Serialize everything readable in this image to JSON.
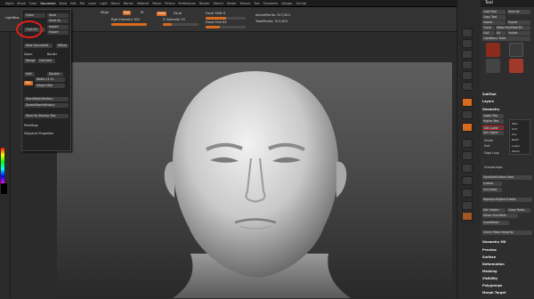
{
  "menubar": {
    "items": [
      "Alpha",
      "Brush",
      "Color",
      "Document",
      "Draw",
      "Edit",
      "File",
      "Layer",
      "Light",
      "Macro",
      "Marker",
      "Material",
      "Movie",
      "Picture",
      "Preferences",
      "Render",
      "Stencil",
      "Stroke",
      "Texture",
      "Tool",
      "Transform",
      "Zplugin",
      "Zscript"
    ],
    "active_index": 3
  },
  "shelf": {
    "light_box": "LightBox",
    "mrgb": "Mrgb",
    "rgb": "Rgb",
    "m": "M",
    "rgb_intensity": "Rgb Intensity 100",
    "zadd": "Zadd",
    "zsub": "Zsub",
    "z_intensity": "Z Intensity 25",
    "focal_shift": "Focal Shift 0",
    "draw_size": "Draw Size 64",
    "active_points": "ActivePoints: 317,612",
    "total_points": "TotalPoints: 317,612"
  },
  "dropdown": {
    "open": "Open",
    "save": "Save",
    "save_as": "Save As",
    "clip_link": "ClipLink",
    "import": "Import",
    "export": "Export",
    "new_document": "New Document",
    "wsize": "WSize",
    "zoom": "Zoom",
    "border": "Border",
    "crop": "Crop",
    "range": "Range",
    "contrast": "Contrast",
    "half": "Half",
    "double": "Double",
    "pro": "Pro",
    "width": "Width 1174",
    "height": "Height 800",
    "store_depth": "StoreDepthHistory",
    "delete_depth": "DeleteDepthHistory",
    "save_startup": "Save As Startup Doc",
    "paint_stop": "PaintStop",
    "zapplink": "ZAppLink Properties"
  },
  "tray": {
    "header": "Tool",
    "load_tool": "Load Tool",
    "save_as": "Save As",
    "copy_tool": "Copy Tool",
    "import": "Import",
    "export": "Export",
    "clone": "Clone",
    "make_polymesh": "Make PolyMesh3D",
    "goz": "GoZ",
    "all": "All",
    "visible": "Visible",
    "lightbox_tools": "Lightbox ▸ Tools",
    "tool_name": "SimpleBrush",
    "subtools": "SubTool",
    "layers": "Layers",
    "geometry": "Geometry",
    "lower_res": "Lower Res",
    "higher_res": "Higher Res",
    "del_lower": "Del Lower",
    "del_higher": "Del Higher",
    "divide": "Divide",
    "smt": "Smt",
    "edge_loop": "Edge Loop",
    "groups_loops": "GroupsLoops",
    "equalize": "EqualizeSurface Area",
    "crease": "Crease",
    "uncrease": "UnCrease",
    "reproject": "ReprojectHigherSubdiv",
    "del_hidden": "Del Hidden",
    "close_holes": "Close Holes",
    "mirror_weld": "Mirror And Weld",
    "insert_mesh": "InsertMesh",
    "check_mesh": "Check Mesh Integrity",
    "geometry_hd": "Geometry HD",
    "preview": "Preview",
    "surface": "Surface",
    "deformation": "Deformation",
    "masking": "Masking",
    "visibility": "Visibility",
    "polygroups": "Polygroups",
    "morph_target": "Morph Target",
    "popup": [
      "SDiv",
      "Smt",
      "Suv",
      "ReUV",
      "Loops",
      "Polish"
    ]
  },
  "colors": {
    "accent": "#d86b20",
    "highlight_circle": "#e0201a",
    "canvas_top": "#5e5e5e",
    "canvas_bottom": "#292929"
  }
}
